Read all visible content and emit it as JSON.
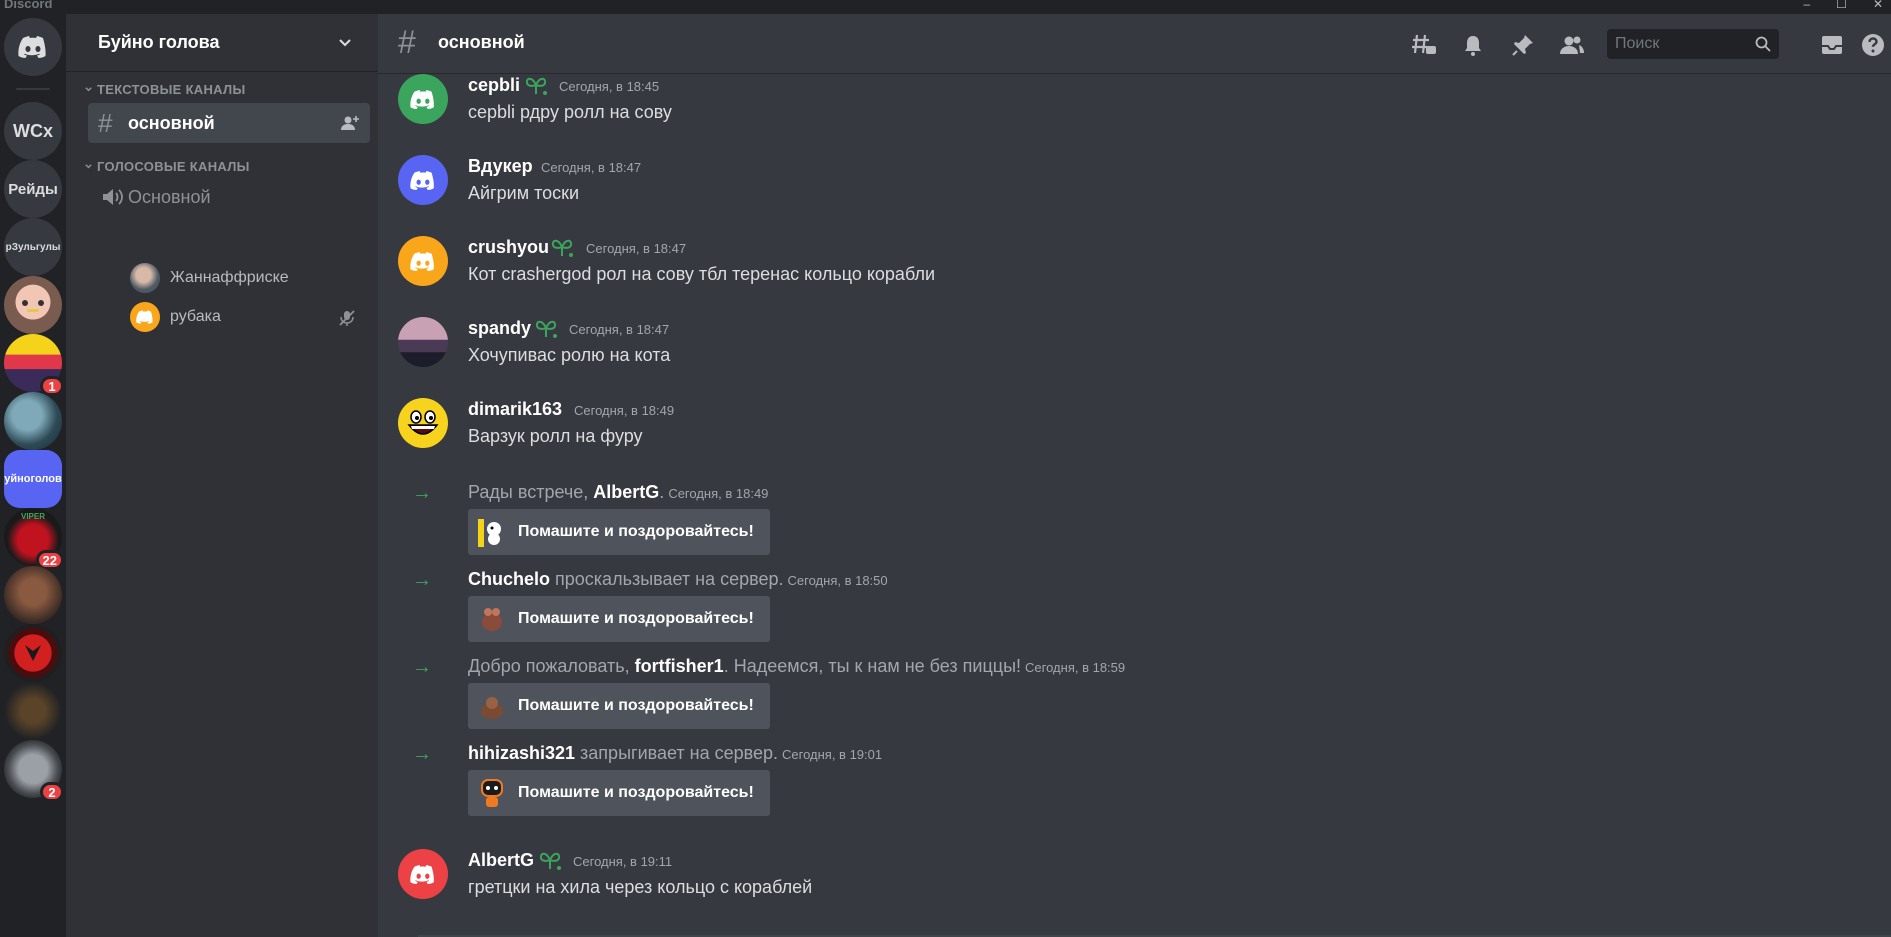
{
  "window": {
    "title": "Discord",
    "controls": [
      "–",
      "☐",
      "✕"
    ]
  },
  "servers": [
    {
      "name": "home",
      "label": ""
    },
    {
      "name": "WCx",
      "label": "WCx"
    },
    {
      "name": "Рейды",
      "label": "Рейды"
    },
    {
      "name": "рЗульгулы",
      "label": "рЗульгулы"
    },
    {
      "name": "server-girl",
      "label": ""
    },
    {
      "name": "server-retro",
      "label": "",
      "badge": "1"
    },
    {
      "name": "server-dragon",
      "label": ""
    },
    {
      "name": "Буйноголов",
      "label": "уйноголов"
    },
    {
      "name": "server-viper",
      "label": "VIPER",
      "badge": "22"
    },
    {
      "name": "server-people",
      "label": ""
    },
    {
      "name": "server-horde",
      "label": ""
    },
    {
      "name": "server-warrior",
      "label": ""
    },
    {
      "name": "server-axe",
      "label": "",
      "badge": "2"
    }
  ],
  "guild": {
    "name": "Буйно голова"
  },
  "categories": {
    "text": "ТЕКСТОВЫЕ КАНАЛЫ",
    "voice": "ГОЛОСОВЫЕ КАНАЛЫ"
  },
  "text_channels": [
    {
      "name": "основной"
    }
  ],
  "voice_channels": [
    {
      "name": "Основной",
      "users": [
        "Жаннаффриске",
        "рубака"
      ]
    }
  ],
  "header": {
    "channel": "основной",
    "search_placeholder": "Поиск"
  },
  "messages": [
    {
      "author": "cepbli",
      "time": "Сегодня, в 18:45",
      "text": "cepbli рдру ролл на сову",
      "color": "#3ba55d"
    },
    {
      "author": "Вдукер",
      "time": "Сегодня, в 18:47",
      "text": "Айгрим тоски",
      "color": "#5865f2"
    },
    {
      "author": "crushyou",
      "time": "Сегодня, в 18:47",
      "text": "Кот crashergod рол на сову тбл теренас кольцо корабли",
      "color": "#faa61a"
    },
    {
      "author": "spandy",
      "time": "Сегодня, в 18:47",
      "text": "Хочупивас ролю на кота",
      "color": "#6b4b5e"
    },
    {
      "author": "dimarik163",
      "time": "Сегодня, в 18:49",
      "text": "Варзук ролл на фуру",
      "color": "#f7d31d"
    }
  ],
  "system": [
    {
      "before": "Рады встрече, ",
      "user": "AlbertG",
      "after": ".",
      "time": "Сегодня, в 18:49",
      "button": "Помашите и поздоровайтесь!"
    },
    {
      "before": "",
      "user": "Chuchelo",
      "after": " проскальзывает на сервер.",
      "time": "Сегодня, в 18:50",
      "button": "Помашите и поздоровайтесь!"
    },
    {
      "before": "Добро пожаловать, ",
      "user": "fortfisher1",
      "after": ". Надеемся, ты к нам не без пиццы!",
      "time": "Сегодня, в 18:59",
      "button": "Помашите и поздоровайтесь!"
    },
    {
      "before": "",
      "user": "hihizashi321",
      "after": " запрыгивает на сервер.",
      "time": "Сегодня, в 19:01",
      "button": "Помашите и поздоровайтесь!"
    }
  ],
  "last_message": {
    "author": "AlbertG",
    "time": "Сегодня, в 19:11",
    "text": "гретцки на хила через кольцо с кораблей",
    "color": "#ed4245"
  }
}
